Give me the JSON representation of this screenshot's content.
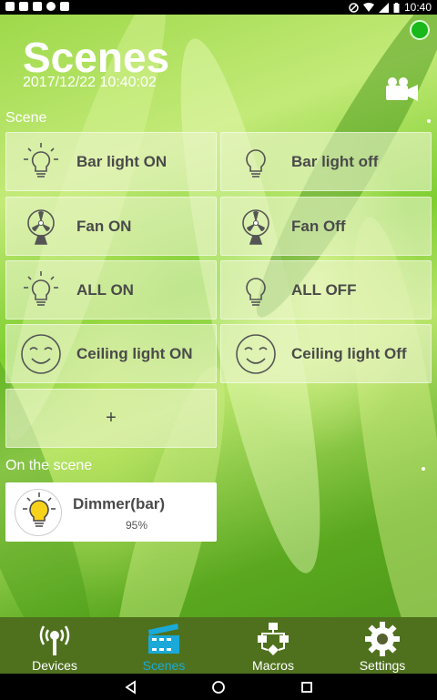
{
  "status_bar": {
    "time": "10:40"
  },
  "header": {
    "title": "Scenes",
    "datetime": "2017/12/22 10:40:02"
  },
  "scene_section": {
    "label": "Scene",
    "scenes": [
      {
        "label": "Bar light ON",
        "icon": "bulb-on-icon"
      },
      {
        "label": "Bar light off",
        "icon": "bulb-off-icon"
      },
      {
        "label": "Fan ON",
        "icon": "fan-icon"
      },
      {
        "label": "Fan Off",
        "icon": "fan-icon"
      },
      {
        "label": "ALL ON",
        "icon": "bulb-on-icon"
      },
      {
        "label": "ALL OFF",
        "icon": "bulb-off-icon"
      },
      {
        "label": "Ceiling light ON",
        "icon": "smiley-icon"
      },
      {
        "label": "Ceiling light Off",
        "icon": "smiley-icon"
      }
    ],
    "add_label": "+"
  },
  "on_scene_section": {
    "label": "On the scene",
    "device": {
      "name": "Dimmer(bar)",
      "level": "95%",
      "icon": "bulb-lit-icon"
    }
  },
  "tabs": [
    {
      "label": "Devices",
      "icon": "devices-icon",
      "active": false
    },
    {
      "label": "Scenes",
      "icon": "clapperboard-icon",
      "active": true
    },
    {
      "label": "Macros",
      "icon": "macros-icon",
      "active": false
    },
    {
      "label": "Settings",
      "icon": "gear-icon",
      "active": false
    }
  ],
  "colors": {
    "status_dot": "#19b81b",
    "active_tab": "#1aa9d8",
    "card_text": "#4a4a4a"
  }
}
